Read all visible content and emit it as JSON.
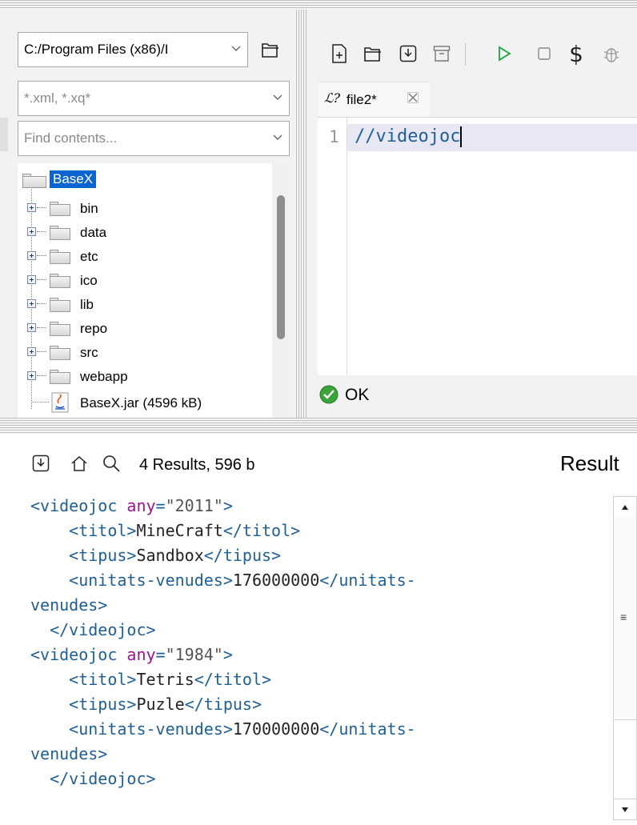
{
  "project": {
    "path_combo": "C:/Program Files (x86)/I",
    "filter_placeholder": "*.xml, *.xq*",
    "find_placeholder": "Find contents...",
    "root": "BaseX",
    "folders": [
      "bin",
      "data",
      "etc",
      "ico",
      "lib",
      "repo",
      "src",
      "webapp"
    ],
    "file": "BaseX.jar (4596 kB)"
  },
  "editor": {
    "tab_label": "file2*",
    "line_number": "1",
    "code_text": "//videojoc",
    "status": "OK"
  },
  "results": {
    "summary": "4 Results, 596 b",
    "panel_title": "Result",
    "lines": [
      {
        "indent": "",
        "parts": [
          [
            "tag",
            "<videojoc "
          ],
          [
            "attr",
            "any"
          ],
          [
            "tag",
            "="
          ],
          [
            "val",
            "\"2011\""
          ],
          [
            "tag",
            ">"
          ]
        ]
      },
      {
        "indent": "    ",
        "parts": [
          [
            "tag",
            "<titol>"
          ],
          [
            "txt",
            "MineCraft"
          ],
          [
            "tag",
            "</titol>"
          ]
        ]
      },
      {
        "indent": "    ",
        "parts": [
          [
            "tag",
            "<tipus>"
          ],
          [
            "txt",
            "Sandbox"
          ],
          [
            "tag",
            "</tipus>"
          ]
        ]
      },
      {
        "indent": "    ",
        "parts": [
          [
            "tag",
            "<unitats-venudes>"
          ],
          [
            "txt",
            "176000000"
          ],
          [
            "tag",
            "</unitats-"
          ]
        ]
      },
      {
        "indent": "",
        "parts": [
          [
            "tag",
            "venudes>"
          ]
        ]
      },
      {
        "indent": "  ",
        "parts": [
          [
            "tag",
            "</videojoc>"
          ]
        ]
      },
      {
        "indent": "",
        "parts": [
          [
            "tag",
            "<videojoc "
          ],
          [
            "attr",
            "any"
          ],
          [
            "tag",
            "="
          ],
          [
            "val",
            "\"1984\""
          ],
          [
            "tag",
            ">"
          ]
        ]
      },
      {
        "indent": "    ",
        "parts": [
          [
            "tag",
            "<titol>"
          ],
          [
            "txt",
            "Tetris"
          ],
          [
            "tag",
            "</titol>"
          ]
        ]
      },
      {
        "indent": "    ",
        "parts": [
          [
            "tag",
            "<tipus>"
          ],
          [
            "txt",
            "Puzle"
          ],
          [
            "tag",
            "</tipus>"
          ]
        ]
      },
      {
        "indent": "    ",
        "parts": [
          [
            "tag",
            "<unitats-venudes>"
          ],
          [
            "txt",
            "170000000"
          ],
          [
            "tag",
            "</unitats-"
          ]
        ]
      },
      {
        "indent": "",
        "parts": [
          [
            "tag",
            "venudes>"
          ]
        ]
      },
      {
        "indent": "  ",
        "parts": [
          [
            "tag",
            "</videojoc>"
          ]
        ]
      }
    ]
  },
  "colors": {
    "accent_selection": "#0a64d2",
    "run_green": "#1fa33a",
    "ok_green": "#3aa33a",
    "xml_tag": "#1f5f94",
    "xml_attr": "#a0138f"
  },
  "icons": {
    "open_folder": "folder-open-icon",
    "new_file": "new-file-icon",
    "save": "save-icon",
    "archive": "archive-icon",
    "run": "play-icon",
    "stop": "stop-icon",
    "variables": "dollar-icon",
    "debug": "bug-icon",
    "ok": "check-circle-icon",
    "home": "home-icon",
    "search": "search-icon"
  }
}
